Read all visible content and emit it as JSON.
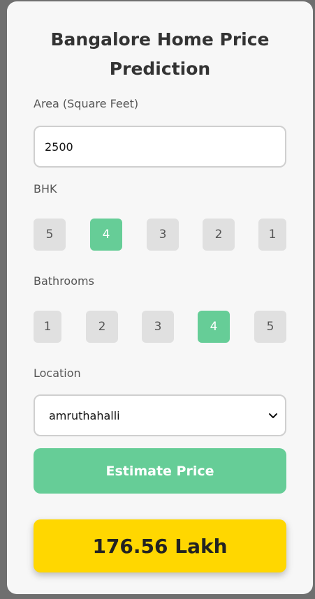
{
  "title_line1": "Bangalore Home Price",
  "title_line2": "Prediction",
  "area": {
    "label": "Area (Square Feet)",
    "value": "2500"
  },
  "bhk": {
    "label": "BHK",
    "options": [
      "5",
      "4",
      "3",
      "2",
      "1"
    ],
    "selected": "4"
  },
  "bathrooms": {
    "label": "Bathrooms",
    "options": [
      "1",
      "2",
      "3",
      "4",
      "5"
    ],
    "selected": "4"
  },
  "location": {
    "label": "Location",
    "value": "amruthahalli"
  },
  "estimate_button": "Estimate Price",
  "result": "176.56 Lakh",
  "colors": {
    "accent": "#66cd97",
    "result_bg": "#ffd700",
    "option_bg": "#e0e0e0",
    "card_bg": "#f7f7f7"
  }
}
